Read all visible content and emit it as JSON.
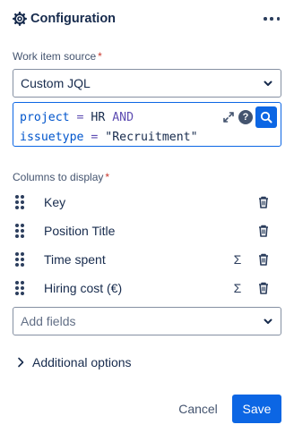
{
  "header": {
    "title": "Configuration",
    "icon": "gear-icon",
    "more_icon": "more-horizontal-icon"
  },
  "source": {
    "label": "Work item source",
    "required_mark": "*",
    "selected": "Custom JQL"
  },
  "jql": {
    "line1": {
      "kw1": "project",
      "op1": " = ",
      "val1": "HR ",
      "kw2": "AND"
    },
    "line2": {
      "kw1": "issuetype",
      "op1": " = ",
      "val1": "\"Recruitment\""
    },
    "expand_icon": "expand-icon",
    "help_icon": "help-icon",
    "help_glyph": "?",
    "search_icon": "search-icon"
  },
  "columns": {
    "label": "Columns to display",
    "required_mark": "*",
    "items": [
      {
        "name": "Key",
        "sum": false
      },
      {
        "name": "Position Title",
        "sum": false
      },
      {
        "name": "Time spent",
        "sum": true
      },
      {
        "name": "Hiring cost (€)",
        "sum": true
      }
    ],
    "sum_glyph": "Σ",
    "add_placeholder": "Add fields"
  },
  "additional": {
    "label": "Additional options"
  },
  "actions": {
    "cancel": "Cancel",
    "save": "Save"
  },
  "colors": {
    "accent": "#0c66e4",
    "required": "#c9372c",
    "text": "#172b4d"
  }
}
